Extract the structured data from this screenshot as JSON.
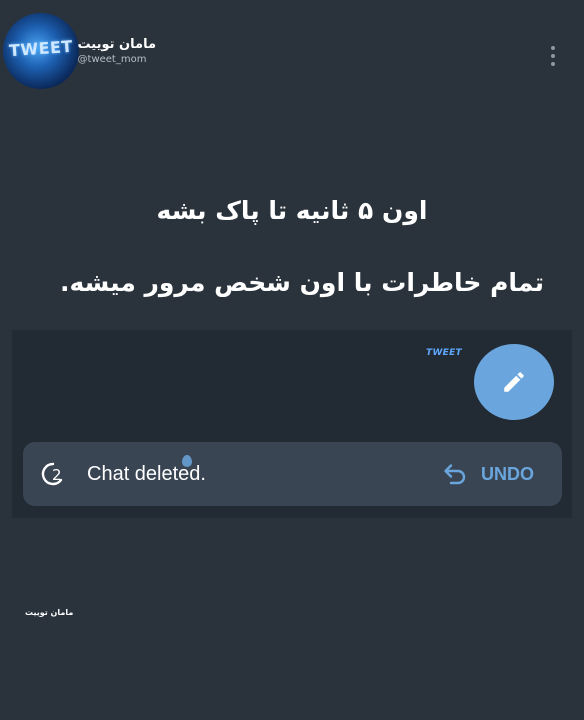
{
  "author": {
    "name": "مامان توییت",
    "handle": "@tweet_mom",
    "avatar_text": "TWEET"
  },
  "caption": {
    "line1": "اون ۵ ثانیه تا پاک بشه",
    "line2": "تمام خاطرات با اون شخص مرور میشه."
  },
  "snackbar": {
    "countdown": "2",
    "message": "Chat deleted.",
    "action": "UNDO"
  },
  "mini_watermark": "TWEET",
  "watermark": "مامان توییت",
  "icons": {
    "more": "more-vert-icon",
    "fab": "pencil-icon",
    "countdown": "timer-ring-icon",
    "undo": "undo-arrow-icon"
  },
  "colors": {
    "background": "#2a333c",
    "panel": "#222a33",
    "snackbar": "#3a4553",
    "accent": "#6aa6dd"
  }
}
